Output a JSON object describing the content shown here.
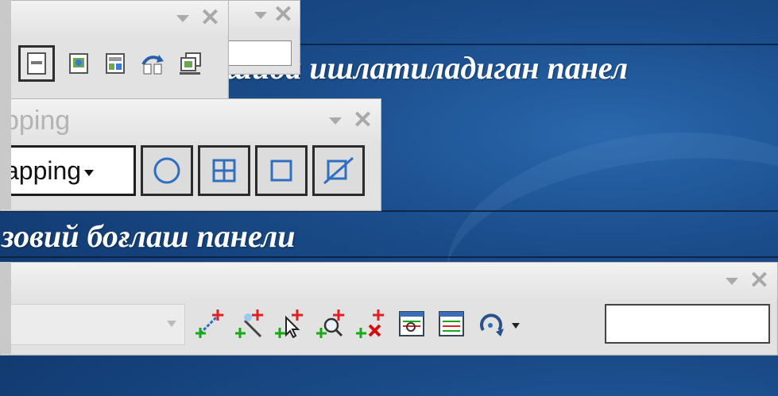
{
  "captions": {
    "top": "шида ишлатиладиган панел",
    "middle": "зовий боғлаш панели"
  },
  "panel_top": {
    "tools": [
      "page-icon",
      "add-data-icon",
      "refresh-layout-icon",
      "copy-map-icon"
    ]
  },
  "panel_small": {
    "input_value": ""
  },
  "snapping_panel": {
    "title": "pping",
    "combo_label": "apping",
    "tools": [
      "point-snap-icon",
      "vertex-snap-icon",
      "edge-snap-icon",
      "end-snap-icon"
    ]
  },
  "bottom_panel": {
    "tools": [
      "add-point-icon",
      "auto-add-icon",
      "select-add-icon",
      "zoom-add-icon",
      "delete-point-icon",
      "view-link-table-icon",
      "link-table-icon",
      "rotate-icon"
    ],
    "input_value": ""
  },
  "colors": {
    "background": "#1b4e8c",
    "panel": "#e2e2e2",
    "caption": "#ffffff"
  }
}
